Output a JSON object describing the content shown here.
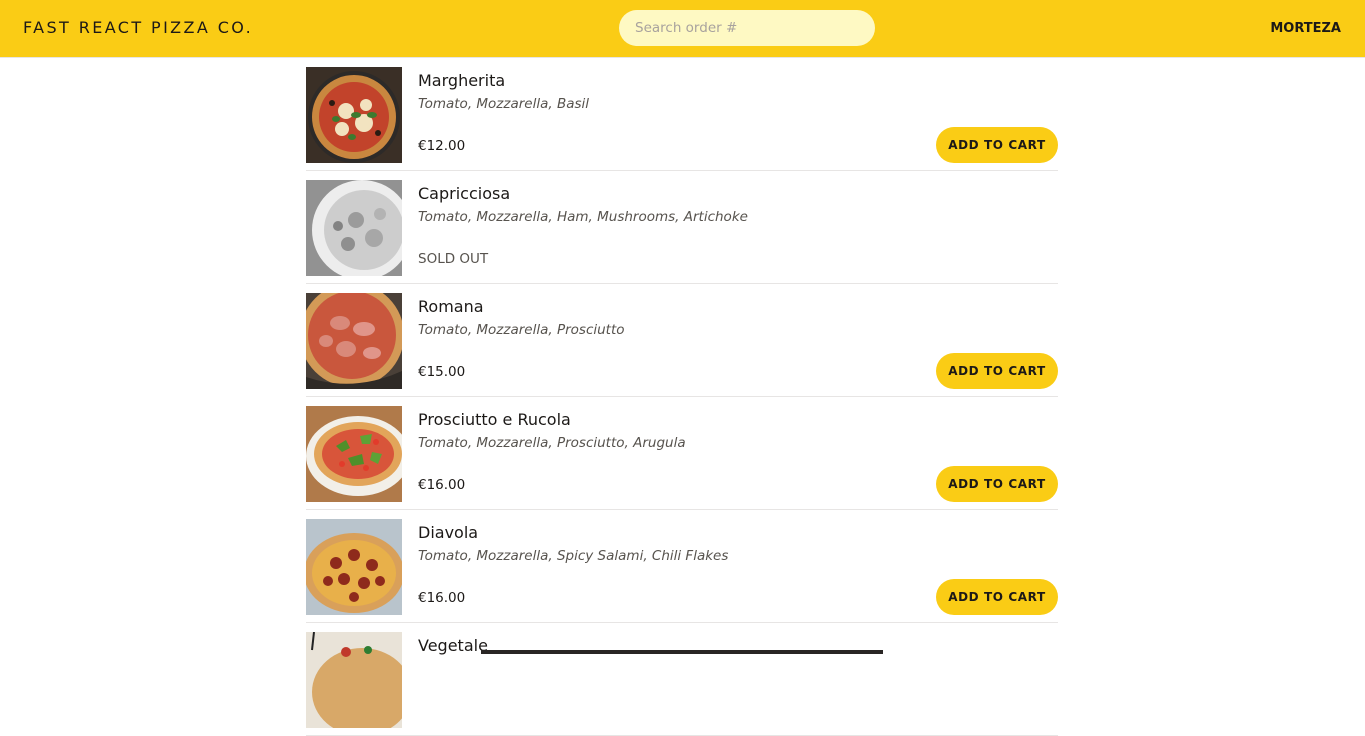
{
  "header": {
    "logo": "Fast React Pizza Co.",
    "search_placeholder": "Search order #",
    "username": "MORTEZA"
  },
  "menu": {
    "items": [
      {
        "name": "Margherita",
        "ingredients": "Tomato, Mozzarella, Basil",
        "price": "€12.00",
        "sold_out": false,
        "button": "Add to cart"
      },
      {
        "name": "Capricciosa",
        "ingredients": "Tomato, Mozzarella, Ham, Mushrooms, Artichoke",
        "price": "",
        "sold_out": true,
        "sold_out_label": "Sold out"
      },
      {
        "name": "Romana",
        "ingredients": "Tomato, Mozzarella, Prosciutto",
        "price": "€15.00",
        "sold_out": false,
        "button": "Add to cart"
      },
      {
        "name": "Prosciutto e Rucola",
        "ingredients": "Tomato, Mozzarella, Prosciutto, Arugula",
        "price": "€16.00",
        "sold_out": false,
        "button": "Add to cart"
      },
      {
        "name": "Diavola",
        "ingredients": "Tomato, Mozzarella, Spicy Salami, Chili Flakes",
        "price": "€16.00",
        "sold_out": false,
        "button": "Add to cart"
      },
      {
        "name": "Vegetale"
      }
    ]
  },
  "colors": {
    "brand": "#facc15",
    "search_bg": "#fef9c3",
    "text": "#1c1917",
    "muted": "#57534e"
  }
}
